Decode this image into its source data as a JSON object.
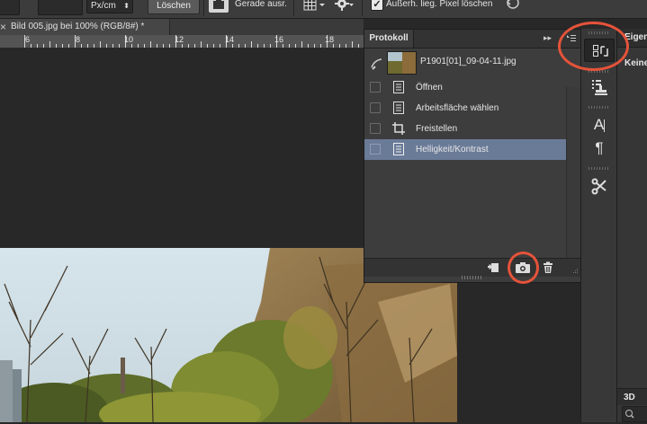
{
  "options_bar": {
    "unit": "Px/cm",
    "clear_label": "Löschen",
    "straighten_label": "Gerade ausr.",
    "delete_cropped_checked": "✓",
    "delete_cropped_label": "Außerh. lieg. Pixel löschen"
  },
  "document_tab": {
    "close": "×",
    "title": "Bild 005.jpg bei 100% (RGB/8#) *"
  },
  "ruler": {
    "labels": [
      "6",
      "8",
      "10",
      "12",
      "14",
      "16",
      "18"
    ]
  },
  "history_panel": {
    "tab_label": "Protokoll",
    "menu_glyph": "▸▸",
    "snapshot_name": "P1901[01]_09-04-11.jpg",
    "items": [
      {
        "label": "Öffnen",
        "selected": false
      },
      {
        "label": "Arbeitsfläche wählen",
        "selected": false
      },
      {
        "label": "Freistellen",
        "selected": false
      },
      {
        "label": "Helligkeit/Kontrast",
        "selected": true
      }
    ]
  },
  "dock": {
    "paragraph_glyph": "¶",
    "char_glyph": "A"
  },
  "right_panel": {
    "title": "Eigen",
    "value": "Keine",
    "bottom_tab": "3D"
  },
  "colors": {
    "selected_row": "#6a7b98",
    "annotation": "#e5533a"
  }
}
